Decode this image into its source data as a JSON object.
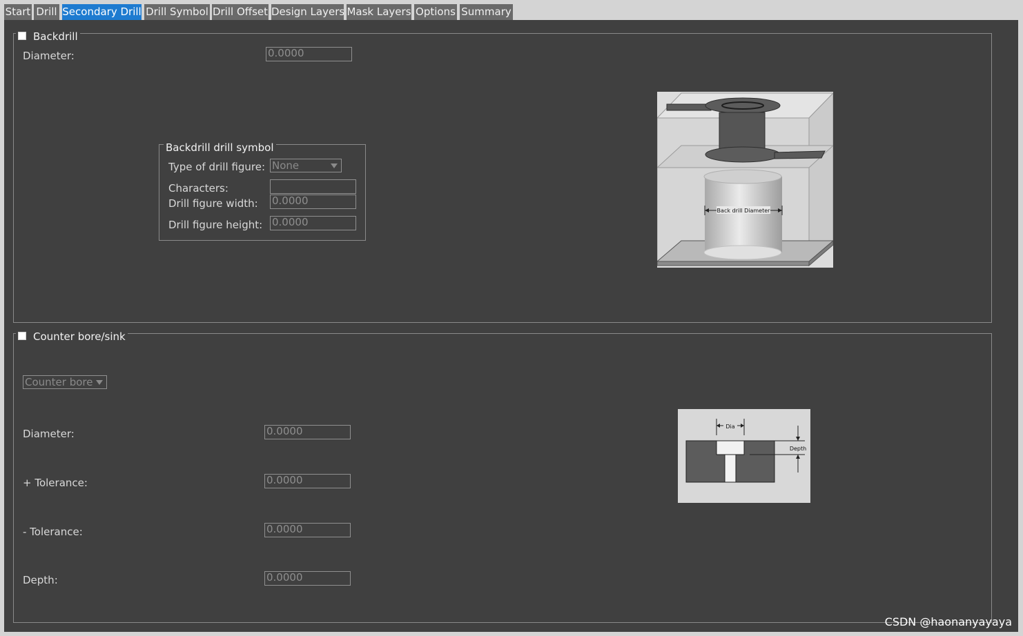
{
  "tabs": [
    {
      "label": "Start",
      "active": false
    },
    {
      "label": "Drill",
      "active": false
    },
    {
      "label": "Secondary Drill",
      "active": true
    },
    {
      "label": "Drill Symbol",
      "active": false
    },
    {
      "label": "Drill Offset",
      "active": false
    },
    {
      "label": "Design Layers",
      "active": false
    },
    {
      "label": "Mask Layers",
      "active": false
    },
    {
      "label": "Options",
      "active": false
    },
    {
      "label": "Summary",
      "active": false
    }
  ],
  "backdrill": {
    "title": "Backdrill",
    "diameter_label": "Diameter:",
    "diameter_value": "0.0000",
    "symbol_group": {
      "title": "Backdrill drill symbol",
      "figure_type_label": "Type of drill figure:",
      "figure_type_value": "None",
      "characters_label": "Characters:",
      "characters_value": "",
      "width_label": "Drill figure width:",
      "width_value": "0.0000",
      "height_label": "Drill figure height:",
      "height_value": "0.0000"
    },
    "diagram_label": "Back drill Diameter"
  },
  "counterbore": {
    "title": "Counter bore/sink",
    "type_value": "Counter bore",
    "diameter_label": "Diameter:",
    "diameter_value": "0.0000",
    "plus_tol_label": "+ Tolerance:",
    "plus_tol_value": "0.0000",
    "minus_tol_label": "- Tolerance:",
    "minus_tol_value": "0.0000",
    "depth_label": "Depth:",
    "depth_value": "0.0000",
    "diagram_dia_label": "Dia",
    "diagram_depth_label": "Depth"
  },
  "watermark": "CSDN @haonanyayaya",
  "colors": {
    "panel_bg": "#404040",
    "active_tab": "#1e7bd0",
    "inactive_tab": "#6a6a6a",
    "window_bg": "#d4d4d4"
  }
}
